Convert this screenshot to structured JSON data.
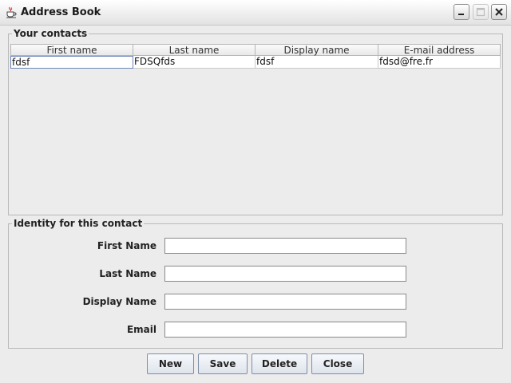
{
  "window": {
    "title": "Address Book"
  },
  "contacts_group": {
    "title": "Your contacts",
    "columns": [
      "First name",
      "Last name",
      "Display name",
      "E-mail address"
    ],
    "rows": [
      [
        "fdsf",
        "FDSQfds",
        "fdsf",
        "fdsd@fre.fr"
      ]
    ]
  },
  "identity_group": {
    "title": "Identity for this contact",
    "fields": [
      {
        "label": "First Name",
        "value": ""
      },
      {
        "label": "Last Name",
        "value": ""
      },
      {
        "label": "Display Name",
        "value": ""
      },
      {
        "label": "Email",
        "value": ""
      }
    ]
  },
  "buttons": {
    "new": "New",
    "save": "Save",
    "delete": "Delete",
    "close": "Close"
  },
  "icons": {
    "app": "java-cup-icon",
    "minimize": "minimize-icon",
    "maximize": "maximize-icon",
    "close": "close-icon"
  }
}
